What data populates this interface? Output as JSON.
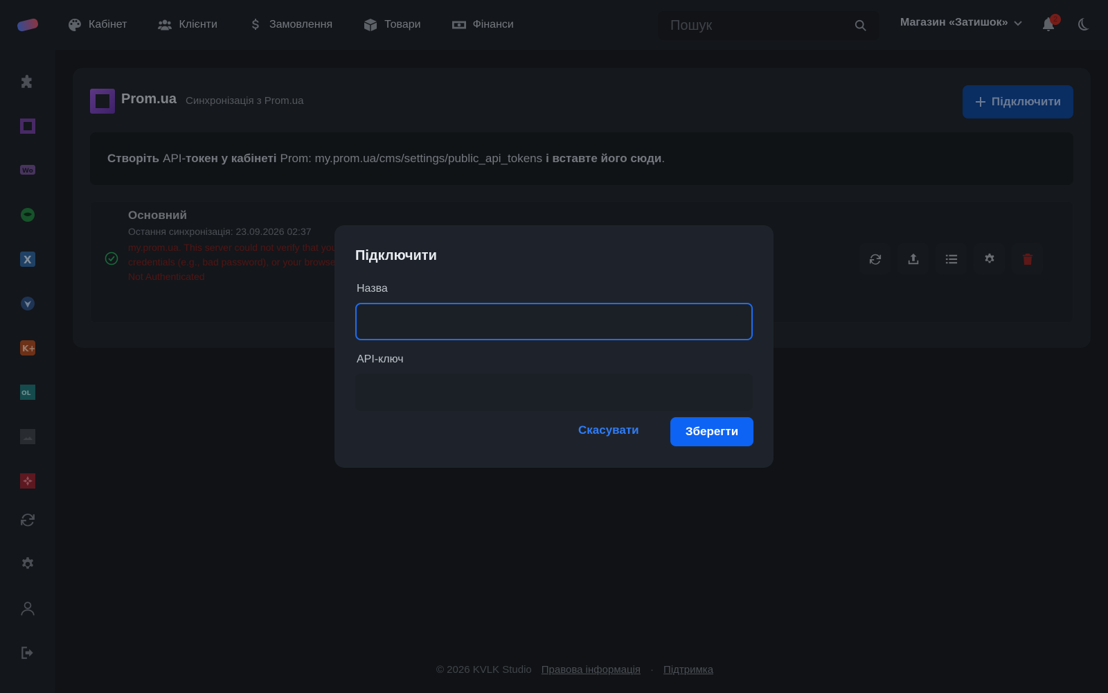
{
  "nav": {
    "items": [
      {
        "label": "Кабінет",
        "icon": "palette-icon"
      },
      {
        "label": "Клієнти",
        "icon": "users-icon"
      },
      {
        "label": "Замовлення",
        "icon": "dollar-icon"
      },
      {
        "label": "Товари",
        "icon": "box-icon"
      },
      {
        "label": "Фінанси",
        "icon": "money-icon"
      }
    ],
    "search_placeholder": "Пошук",
    "store_name": "Магазин «Затишок»",
    "notifications_count": "2"
  },
  "sidebar": {
    "items": [
      "puzzle-icon",
      "prom-icon",
      "woo-icon",
      "horoshop-icon",
      "x-icon",
      "shield-icon",
      "kasta-icon",
      "olx-icon",
      "image-icon",
      "rozetka-icon",
      "sync-icon",
      "settings-icon",
      "user-icon",
      "logout-icon"
    ]
  },
  "card": {
    "title": "Prom.ua",
    "subtitle": "Синхронізація з Prom.ua",
    "connect_label": "Підключити",
    "info_bold1": "Створіть",
    "info_text1": "API-",
    "info_bold2": "токен у кабінеті",
    "info_text2": "Prom: my.prom.ua/cms/settings/public_api_tokens",
    "info_bold3": "і вставте його сюди",
    "info_text3": ".",
    "integration": {
      "name": "Основний",
      "last_sync": "Остання синхронізація: 23.09.2026 02:37",
      "error_line1": "my.prom.ua. This server could not verify that you are authorized to access the document requested. Either you supplied the wrong",
      "error_line2": "credentials (e.g., bad password), or your browser doesn't understand how to supply the credentials required.",
      "error_line3": "Not Authenticated"
    }
  },
  "modal": {
    "title": "Підключити",
    "name_label": "Назва",
    "name_value": "",
    "api_label": "API-ключ",
    "api_value": "",
    "cancel_label": "Скасувати",
    "save_label": "Зберегти"
  },
  "footer": {
    "copyright": "© 2026 KVLK Studio",
    "legal": "Правова інформація",
    "separator": "·",
    "support": "Підтримка"
  },
  "colors": {
    "accent": "#0d63f3",
    "error": "#7a1a17",
    "success": "#1f9e55"
  }
}
